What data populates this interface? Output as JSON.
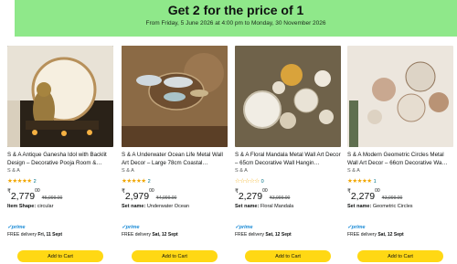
{
  "banner": {
    "title": "Get 2 for the price of 1",
    "subtitle": "From Friday, 5 June 2026 at 4:00 pm to Monday, 30 November 2026"
  },
  "products": [
    {
      "name": "S & A Antique Ganesha Idol with Backlit Design – Decorative Pooja Room &…",
      "brand": "S & A",
      "stars": "★★★★★",
      "rating_count": "2",
      "currency": "₹",
      "price": "2,779",
      "price_dec": "00",
      "mrp": "₹5,999.00",
      "attr_label": "Item Shape:",
      "attr_value": "circular",
      "prime": "✓prime",
      "delivery_prefix": "FREE delivery",
      "delivery_date": "Fri, 11 Sept",
      "button": "Add to Cart"
    },
    {
      "name": "S & A Underwater Ocean Life Metal Wall Art Decor – Large 78cm Coastal…",
      "brand": "S & A",
      "stars": "★★★★★",
      "rating_count": "2",
      "currency": "₹",
      "price": "2,979",
      "price_dec": "00",
      "mrp": "₹4,999.00",
      "attr_label": "Set name:",
      "attr_value": "Underwater Ocean",
      "prime": "✓prime",
      "delivery_prefix": "FREE delivery",
      "delivery_date": "Sat, 12 Sept",
      "button": "Add to Cart"
    },
    {
      "name": "S & A Floral Mandala Metal Wall Art Decor – 65cm Decorative Wall Hangin…",
      "brand": "S & A",
      "stars": "☆☆☆☆☆",
      "rating_count": "0",
      "currency": "₹",
      "price": "2,279",
      "price_dec": "00",
      "mrp": "₹3,999.00",
      "attr_label": "Set name:",
      "attr_value": "Floral Mandala",
      "prime": "✓prime",
      "delivery_prefix": "FREE delivery",
      "delivery_date": "Sat, 12 Sept",
      "button": "Add to Cart"
    },
    {
      "name": "S & A Modern Geometric Circles Metal Wall Art Decor – 66cm Decorative Wa…",
      "brand": "S & A",
      "stars": "★★★★★",
      "rating_count": "1",
      "currency": "₹",
      "price": "2,279",
      "price_dec": "00",
      "mrp": "₹3,999.00",
      "attr_label": "Set name:",
      "attr_value": "Geometric Circles",
      "prime": "✓prime",
      "delivery_prefix": "FREE delivery",
      "delivery_date": "Sat, 12 Sept",
      "button": "Add to Cart"
    }
  ]
}
